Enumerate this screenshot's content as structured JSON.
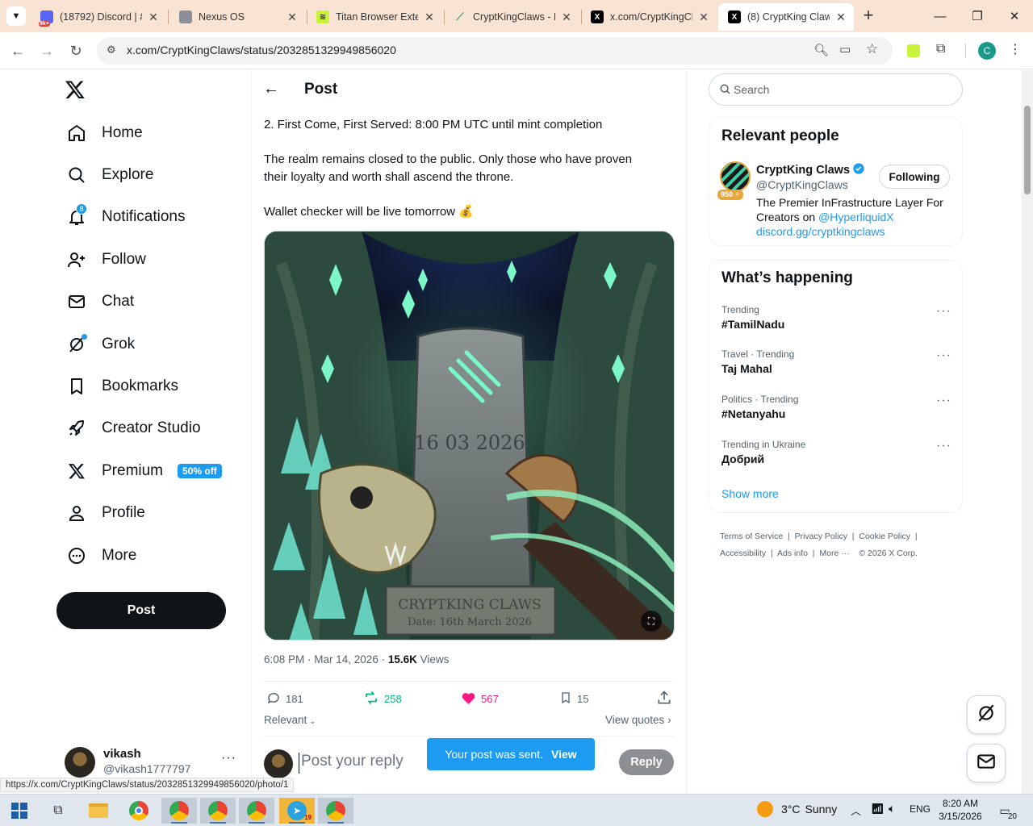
{
  "browser": {
    "tabs": [
      {
        "title": "(18792) Discord | #",
        "favicon_badge": "9k+"
      },
      {
        "title": "Nexus OS"
      },
      {
        "title": "Titan Browser Exte"
      },
      {
        "title": "CryptKingClaws - D"
      },
      {
        "title": "x.com/CryptKingCl"
      },
      {
        "title": "(8) CryptKing Claw"
      }
    ],
    "active_tab_index": 5,
    "url": "x.com/CryptKingClaws/status/2032851329949856020",
    "profile_initial": "C",
    "status_url": "https://x.com/CryptKingClaws/status/2032851329949856020/photo/1"
  },
  "sidebar": {
    "items": [
      {
        "label": "Home",
        "icon": "home-icon"
      },
      {
        "label": "Explore",
        "icon": "search-icon"
      },
      {
        "label": "Notifications",
        "icon": "bell-icon",
        "badge": "8"
      },
      {
        "label": "Follow",
        "icon": "person-add-icon"
      },
      {
        "label": "Chat",
        "icon": "mail-icon"
      },
      {
        "label": "Grok",
        "icon": "grok-icon"
      },
      {
        "label": "Bookmarks",
        "icon": "bookmark-icon"
      },
      {
        "label": "Creator Studio",
        "icon": "rocket-icon"
      },
      {
        "label": "Premium",
        "icon": "x-logo-icon",
        "badge": "50% off"
      },
      {
        "label": "Profile",
        "icon": "person-icon"
      },
      {
        "label": "More",
        "icon": "more-circle-icon"
      }
    ],
    "post_button": "Post",
    "account": {
      "name": "vikash",
      "handle": "@vikash1777797"
    }
  },
  "post": {
    "header_title": "Post",
    "line1": "2. First Come, First Served: 8:00 PM UTC until mint completion",
    "para2_line1": "The realm remains closed to the public. Only those who have proven",
    "para2_line2": "their loyalty and worth shall ascend the throne.",
    "para3": "Wallet checker will be live tomorrow 💰",
    "image": {
      "tombstone_date": "16 03 2026",
      "plaque_title": "CRYPTKING CLAWS",
      "plaque_date": "Date: 16th March 2026"
    },
    "timestamp": "6:08 PM · Mar 14, 2026 · ",
    "views_count": "15.6K",
    "views_label": " Views",
    "stats": {
      "replies": "181",
      "reposts": "258",
      "likes": "567",
      "bookmarks": "15"
    },
    "sort_label": "Relevant",
    "view_quotes": "View quotes",
    "reply_placeholder": "Post your reply",
    "reply_button": "Reply",
    "toast_text": "Your post was sent.",
    "toast_action": "View"
  },
  "right": {
    "search_placeholder": "Search",
    "relevant_title": "Relevant people",
    "person": {
      "name": "CryptKing Claws",
      "handle": "@CryptKingClaws",
      "score": "950",
      "follow_label": "Following",
      "bio_line1": "The Premier InFrastructure Layer For",
      "bio_line2_prefix": "Creators on ",
      "bio_mention": "@HyperliquidX",
      "bio_link": "discord.gg/cryptkingclaws"
    },
    "happening_title": "What’s happening",
    "trends": [
      {
        "meta": "Trending",
        "name": "#TamilNadu"
      },
      {
        "meta": "Travel · Trending",
        "name": "Taj Mahal"
      },
      {
        "meta": "Politics · Trending",
        "name": "#Netanyahu"
      },
      {
        "meta": "Trending in Ukraine",
        "name": "Добрий"
      }
    ],
    "show_more": "Show more",
    "footer": [
      "Terms of Service",
      "Privacy Policy",
      "Cookie Policy",
      "Accessibility",
      "Ads info",
      "More ···",
      "© 2026 X Corp."
    ]
  },
  "taskbar": {
    "weather_temp": "3°C",
    "weather_desc": "Sunny",
    "language": "ENG",
    "time": "8:20 AM",
    "date": "3/15/2026",
    "notification_count": "20",
    "telegram_badge": "19"
  },
  "colors": {
    "accent": "#1d9bf0",
    "repost": "#00ba7c",
    "like": "#f91880",
    "tabbar": "#f9e3d3"
  }
}
